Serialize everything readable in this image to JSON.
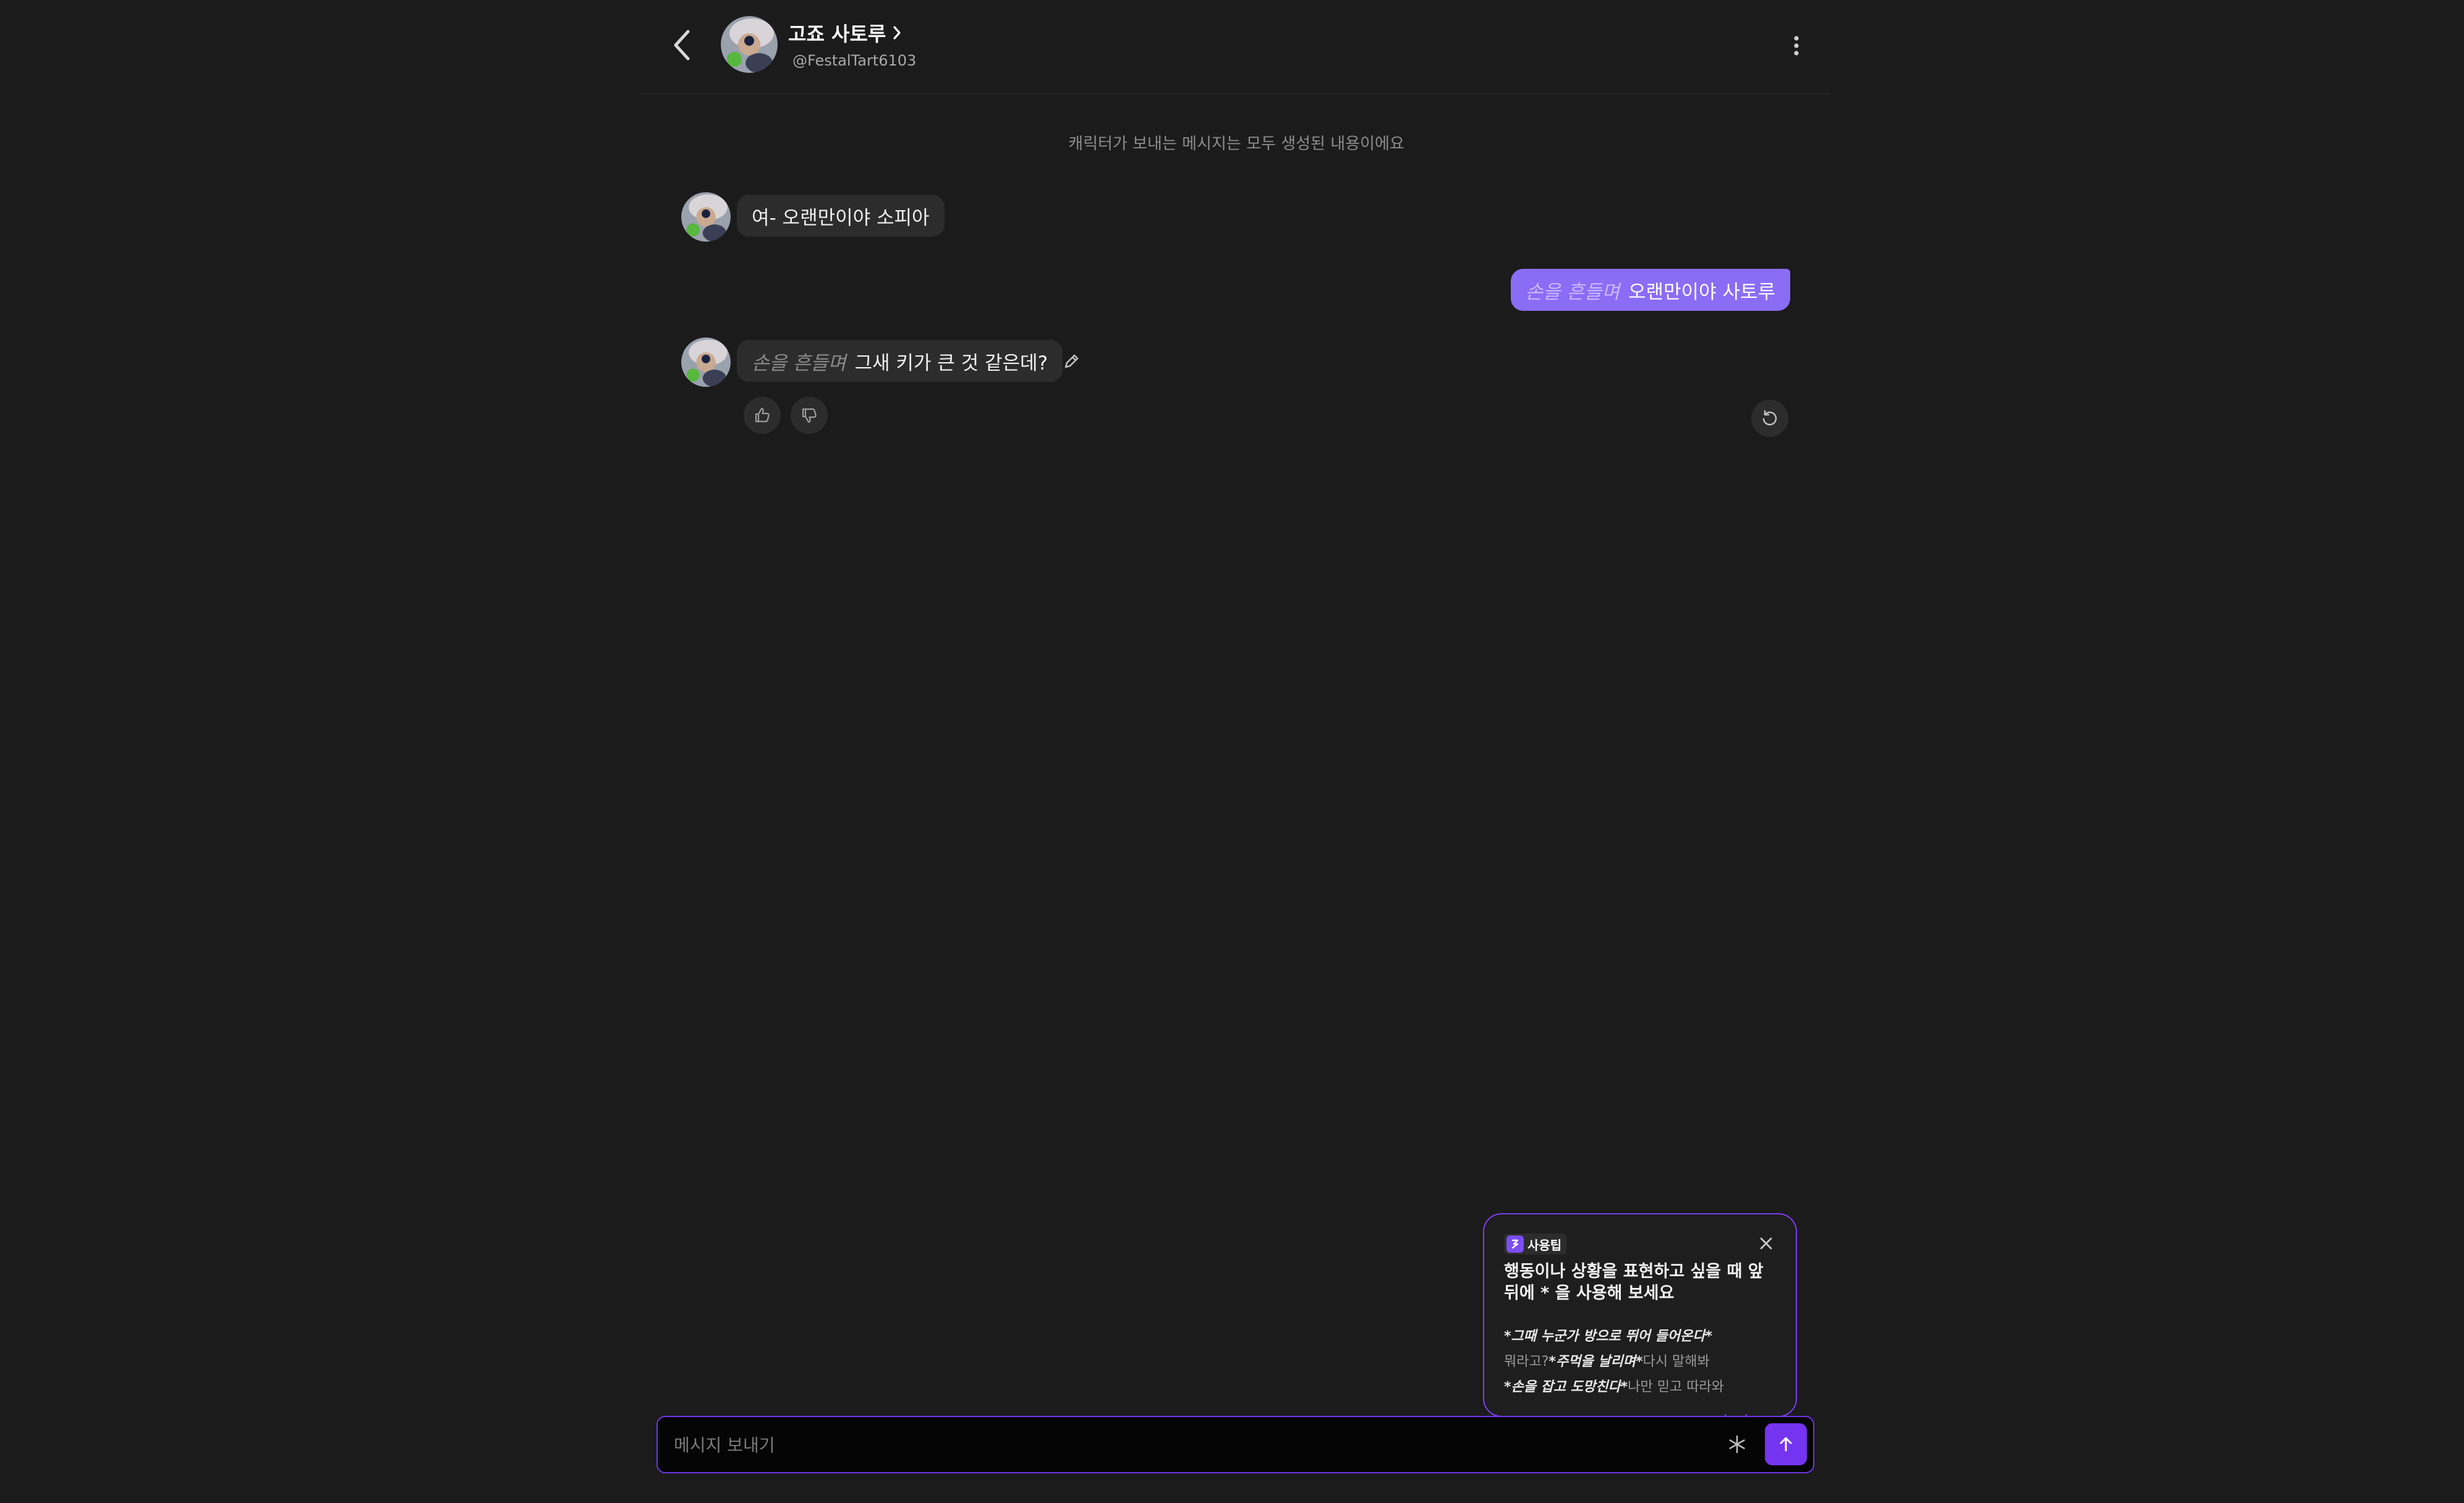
{
  "header": {
    "character_name": "고죠 사토루",
    "handle": "@FestalTart6103"
  },
  "notice": "캐릭터가 보내는 메시지는 모두 생성된 내용이에요",
  "messages": [
    {
      "sender": "character",
      "action": "",
      "text": "여- 오랜만이야 소피아"
    },
    {
      "sender": "user",
      "action": "손을 흔들며",
      "text": "오랜만이야 사토루"
    },
    {
      "sender": "character",
      "action": "손을 흔들며",
      "text": "그새 키가 큰 것 같은데?"
    }
  ],
  "tip": {
    "badge": "사용팁",
    "heading": "행동이나 상황을 표현하고 싶을 때 앞뒤에 * 을 사용해 보세요",
    "examples": [
      {
        "emphasis": "*그때 누군가 방으로 뛰어 들어온다*",
        "before": "",
        "after": ""
      },
      {
        "before": "뭐라고?",
        "emphasis": "*주먹을 날리며*",
        "after": "다시 말해봐"
      },
      {
        "before": "",
        "emphasis": "*손을 잡고 도망친다*",
        "after": "나만 믿고 따라와"
      }
    ]
  },
  "input": {
    "placeholder": "메시지 보내기",
    "value": ""
  },
  "colors": {
    "background": "#1b1b1b",
    "user_bubble": "#8b6cf5",
    "accent": "#7534f0",
    "bubble": "#2c2c2c"
  }
}
